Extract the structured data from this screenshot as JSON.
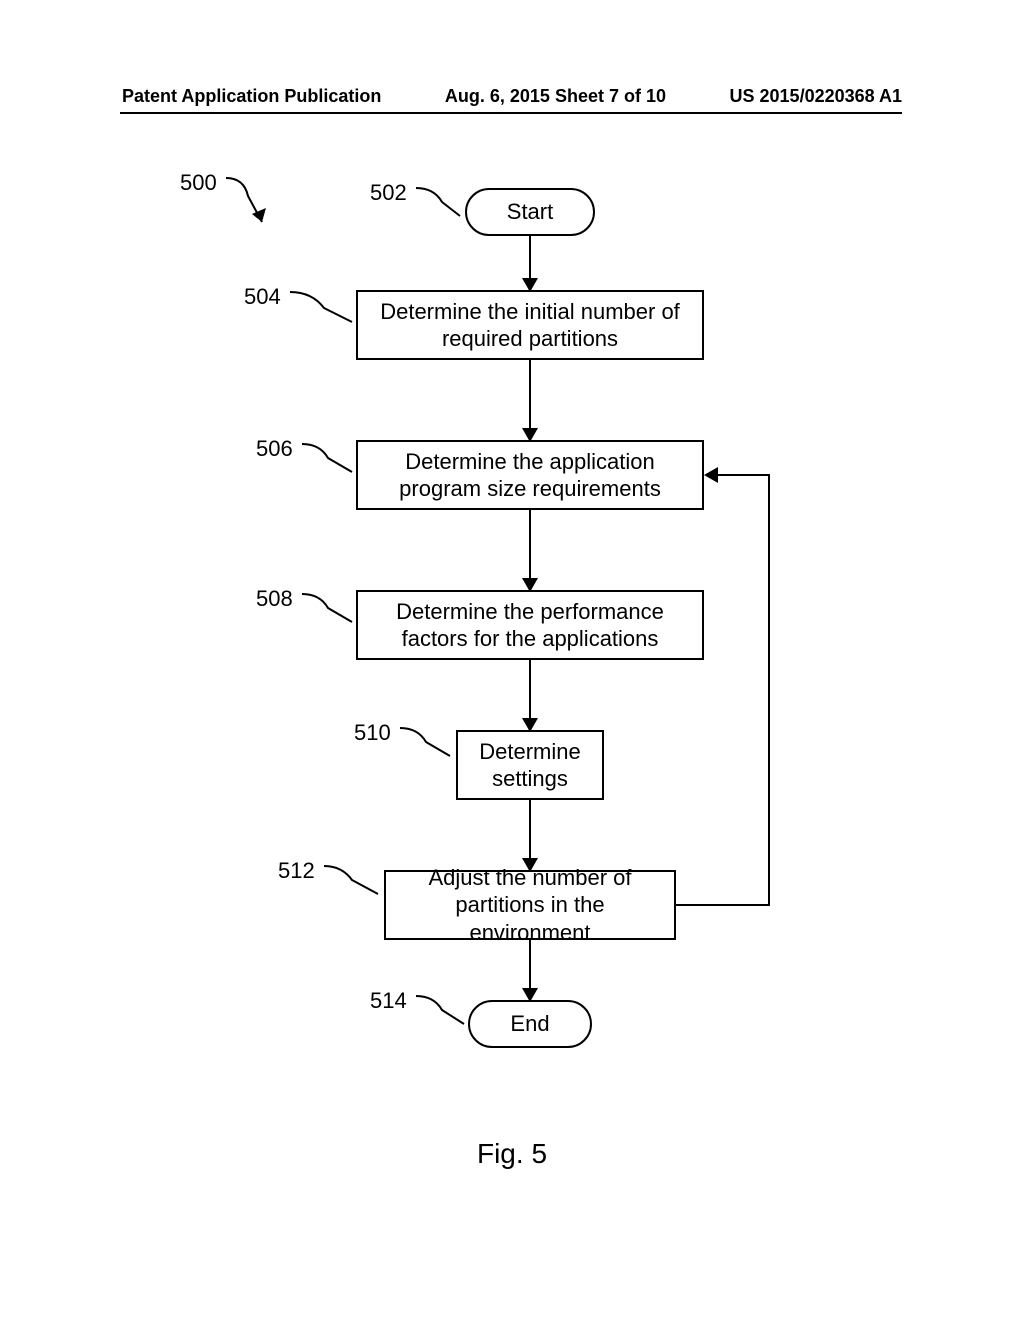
{
  "header": {
    "left": "Patent Application Publication",
    "center": "Aug. 6, 2015   Sheet 7 of 10",
    "right": "US 2015/0220368 A1"
  },
  "labels": {
    "l500": "500",
    "l502": "502",
    "l504": "504",
    "l506": "506",
    "l508": "508",
    "l510": "510",
    "l512": "512",
    "l514": "514"
  },
  "nodes": {
    "start": "Start",
    "n504": "Determine the initial number of required partitions",
    "n506": "Determine the application program size requirements",
    "n508": "Determine the performance factors for the applications",
    "n510": "Determine settings",
    "n512": "Adjust the number of partitions in the environment",
    "end": "End"
  },
  "figure": "Fig. 5",
  "chart_data": {
    "type": "flowchart",
    "title": "Fig. 5",
    "overall_ref": "500",
    "nodes": [
      {
        "id": "502",
        "type": "terminal",
        "label": "Start"
      },
      {
        "id": "504",
        "type": "process",
        "label": "Determine the initial number of required partitions"
      },
      {
        "id": "506",
        "type": "process",
        "label": "Determine the application program size requirements"
      },
      {
        "id": "508",
        "type": "process",
        "label": "Determine the performance factors for the applications"
      },
      {
        "id": "510",
        "type": "process",
        "label": "Determine settings"
      },
      {
        "id": "512",
        "type": "process",
        "label": "Adjust the number of partitions in the environment"
      },
      {
        "id": "514",
        "type": "terminal",
        "label": "End"
      }
    ],
    "edges": [
      {
        "from": "502",
        "to": "504"
      },
      {
        "from": "504",
        "to": "506"
      },
      {
        "from": "506",
        "to": "508"
      },
      {
        "from": "508",
        "to": "510"
      },
      {
        "from": "510",
        "to": "512"
      },
      {
        "from": "512",
        "to": "514"
      },
      {
        "from": "512",
        "to": "506",
        "note": "feedback loop"
      }
    ]
  }
}
